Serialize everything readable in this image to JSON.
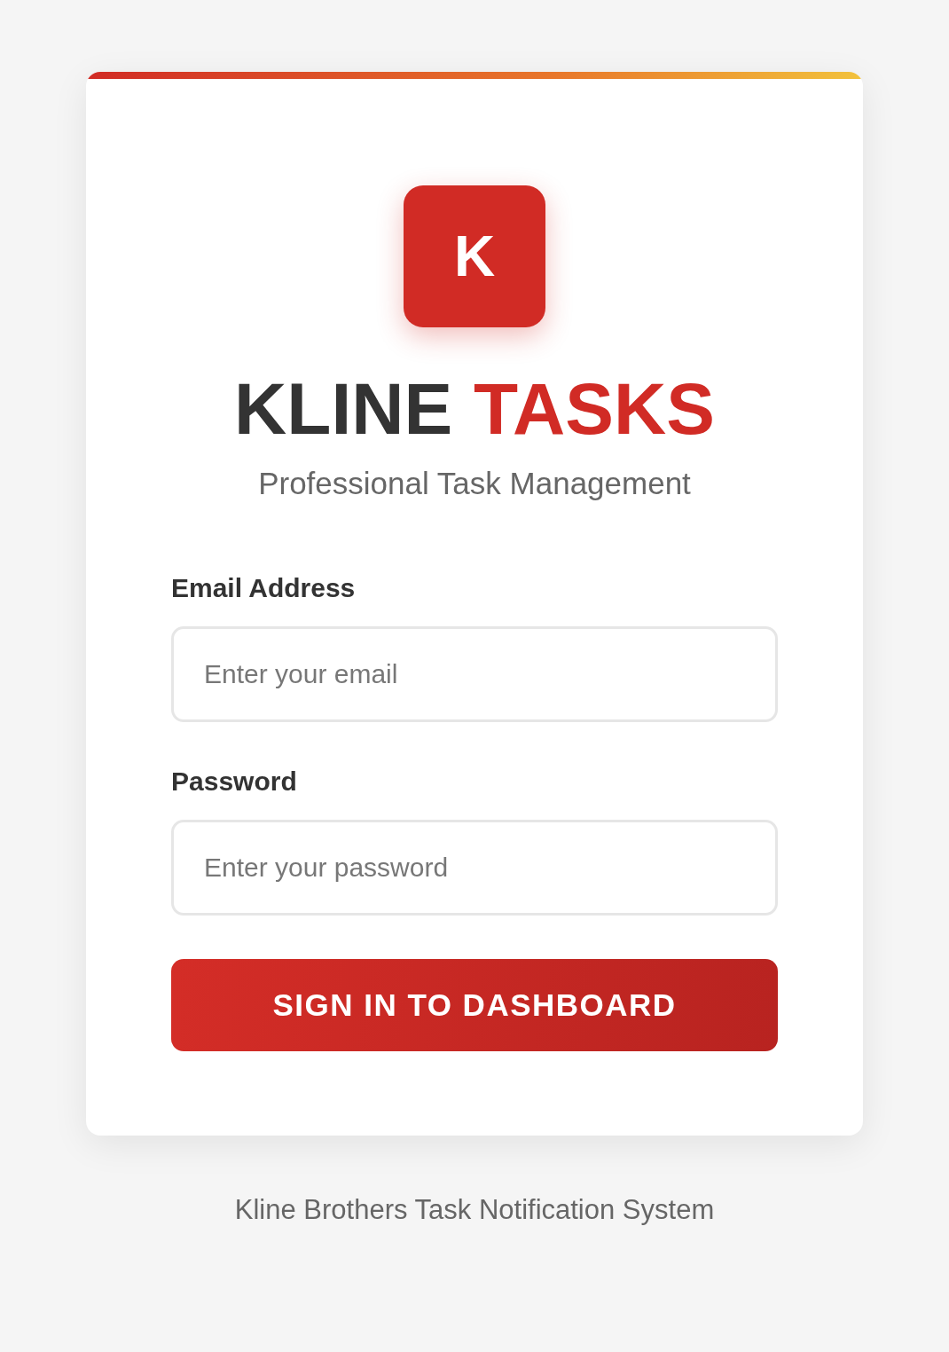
{
  "logo": {
    "letter": "K"
  },
  "title": [
    {
      "text": "KLINE",
      "accent": false
    },
    {
      "text": "TASKS",
      "accent": true
    }
  ],
  "subtitle": "Professional Task Management",
  "fields": [
    {
      "label": "Email Address",
      "placeholder": "Enter your email"
    },
    {
      "label": "Password",
      "placeholder": "Enter your password"
    }
  ],
  "button": "SIGN IN TO DASHBOARD",
  "footer": "Kline Brothers Task Notification System"
}
